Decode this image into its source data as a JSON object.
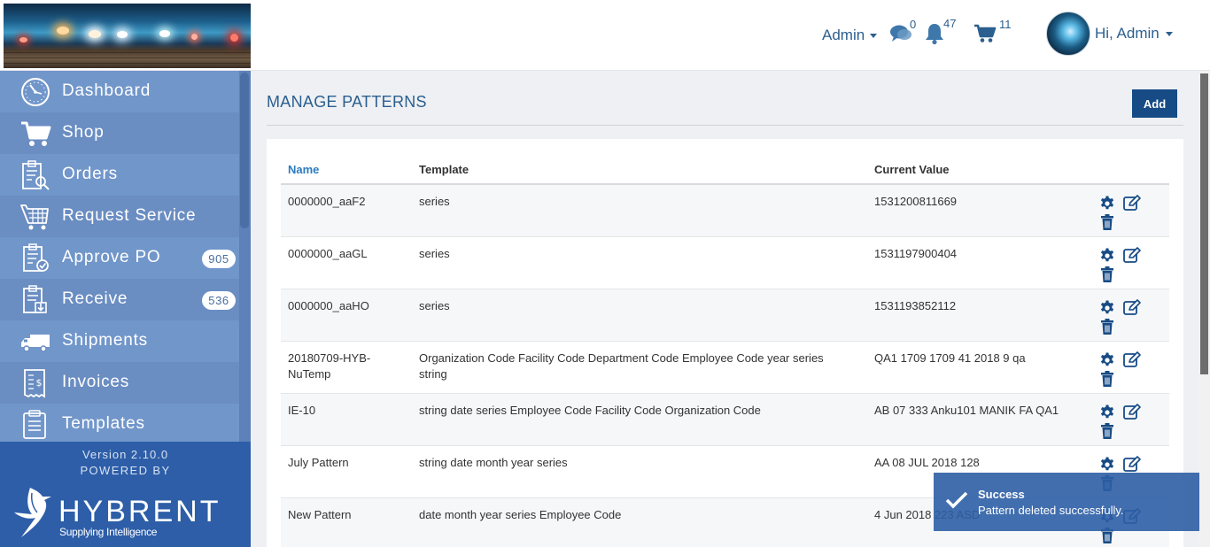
{
  "header": {
    "user_menu_label": "Admin",
    "messages_count": "0",
    "notifications_count": "47",
    "cart_count": "11",
    "greeting": "Hi, Admin"
  },
  "sidebar": {
    "items": [
      {
        "label": "Dashboard",
        "icon": "dashboard-icon"
      },
      {
        "label": "Shop",
        "icon": "cart-icon"
      },
      {
        "label": "Orders",
        "icon": "orders-icon"
      },
      {
        "label": "Request Service",
        "icon": "request-service-icon"
      },
      {
        "label": "Approve PO",
        "icon": "approve-icon",
        "badge": "905"
      },
      {
        "label": "Receive",
        "icon": "receive-icon",
        "badge": "536"
      },
      {
        "label": "Shipments",
        "icon": "truck-icon"
      },
      {
        "label": "Invoices",
        "icon": "invoice-icon"
      },
      {
        "label": "Templates",
        "icon": "templates-icon"
      }
    ],
    "version": "Version 2.10.0",
    "powered_by": "POWERED BY",
    "brand_name": "HYBRENT",
    "brand_tagline": "Supplying Intelligence"
  },
  "page": {
    "title": "MANAGE PATTERNS",
    "add_label": "Add"
  },
  "table": {
    "columns": {
      "name": "Name",
      "template": "Template",
      "current_value": "Current Value"
    },
    "rows": [
      {
        "name": "0000000_aaF2",
        "template": "series",
        "value": "1531200811669"
      },
      {
        "name": "0000000_aaGL",
        "template": "series",
        "value": "1531197900404"
      },
      {
        "name": "0000000_aaHO",
        "template": "series",
        "value": "1531193852112"
      },
      {
        "name": "20180709-HYB-NuTemp",
        "template": "Organization Code Facility Code Department Code Employee Code year series string",
        "value": "QA1 1709 1709 41 2018 9 qa"
      },
      {
        "name": "IE-10",
        "template": "string date series Employee Code Facility Code Organization Code",
        "value": "AB 07 333 Anku101 MANIK FA QA1"
      },
      {
        "name": "July Pattern",
        "template": "string date month year series",
        "value": "AA 08 JUL 2018 128"
      },
      {
        "name": "New Pattern",
        "template": "date month year series Employee Code",
        "value": "4 Jun 2018 223 ASD"
      }
    ]
  },
  "toast": {
    "title": "Success",
    "message": "Pattern deleted successfully."
  },
  "colors": {
    "brand_blue": "#174b85",
    "sidebar_blue": "#6c8fc4",
    "footer_blue": "#2e5ea8",
    "link_blue": "#2b5f8f"
  }
}
